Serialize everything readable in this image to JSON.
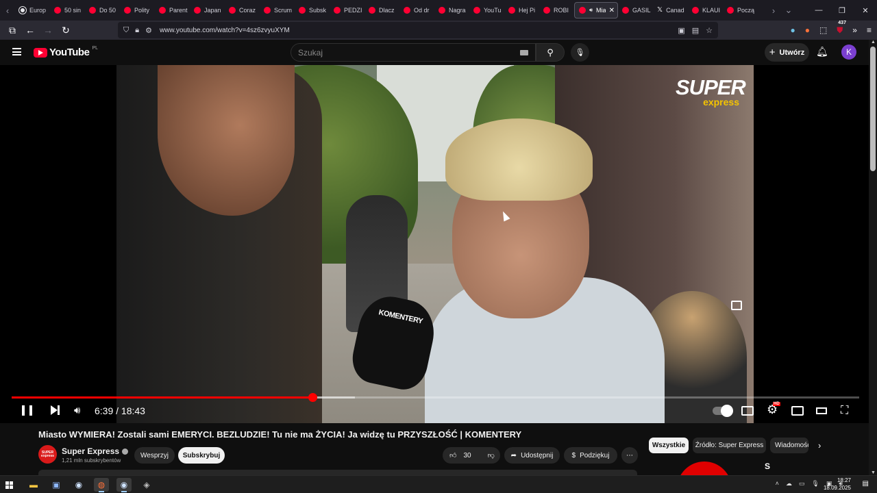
{
  "browser": {
    "tabs": [
      {
        "label": "Europ",
        "icon": "globe-icon"
      },
      {
        "label": "50 sin",
        "icon": "youtube-icon"
      },
      {
        "label": "Do 50",
        "icon": "youtube-icon"
      },
      {
        "label": "Polity",
        "icon": "youtube-icon"
      },
      {
        "label": "Parent",
        "icon": "youtube-icon"
      },
      {
        "label": "Japan",
        "icon": "youtube-icon"
      },
      {
        "label": "Coraz",
        "icon": "youtube-icon"
      },
      {
        "label": "Scrum",
        "icon": "youtube-icon"
      },
      {
        "label": "Subsk",
        "icon": "youtube-icon"
      },
      {
        "label": "PEDZI",
        "icon": "youtube-icon"
      },
      {
        "label": "Dlacz",
        "icon": "youtube-icon"
      },
      {
        "label": "Od dr",
        "icon": "youtube-icon"
      },
      {
        "label": "Nagra",
        "icon": "youtube-icon"
      },
      {
        "label": "YouTu",
        "icon": "youtube-icon"
      },
      {
        "label": "Hej Pi",
        "icon": "youtube-icon"
      },
      {
        "label": "ROBI",
        "icon": "youtube-icon"
      },
      {
        "label": "Mia",
        "icon": "youtube-icon",
        "active": true
      },
      {
        "label": "GASIL",
        "icon": "youtube-icon"
      },
      {
        "label": "Canad",
        "icon": "x-icon"
      },
      {
        "label": "KLAUI",
        "icon": "youtube-icon"
      },
      {
        "label": "Począ",
        "icon": "youtube-icon"
      }
    ],
    "url": "www.youtube.com/watch?v=4sz6zvyuXYM",
    "extension_badge": "437"
  },
  "youtube": {
    "logo_text": "YouTube",
    "logo_region": "PL",
    "search_placeholder": "Szukaj",
    "create_label": "Utwórz",
    "avatar_letter": "K"
  },
  "player": {
    "brand_line1": "SUPER",
    "brand_line2": "express",
    "mic_text": "KOMENTERY",
    "current_time": "6:39",
    "duration": "18:43",
    "time_display": "6:39 / 18:43",
    "progress_fraction": 0.355,
    "buffered_fraction": 0.405,
    "hd_badge": "HD"
  },
  "video": {
    "title": "Miasto WYMIERA! Zostali sami EMERYCI. BEZLUDZIE! Tu nie ma ŻYCIA! Ja widzę tu PRZYSZŁOŚĆ | KOMENTERY",
    "channel_name": "Super Express",
    "channel_avatar_text": "SUPER express",
    "subscribers": "1,21 mln subskrybentów",
    "support_label": "Wesprzyj",
    "subscribe_label": "Subskrybuj",
    "likes": "30",
    "share_label": "Udostępnij",
    "thanks_label": "Podziękuj",
    "more_label": "⋯"
  },
  "filters": [
    {
      "label": "Wszystkie",
      "active": true
    },
    {
      "label": "Źródło: Super Express",
      "active": false
    },
    {
      "label": "Wiadomości",
      "active": false
    }
  ],
  "sidebar_partial": {
    "letter": "S"
  },
  "taskbar": {
    "time": "18:27",
    "date": "18.09.2025"
  },
  "colors": {
    "yt_red": "#ff0033",
    "progress_red": "#ff0000",
    "background": "#0f0f0f"
  }
}
